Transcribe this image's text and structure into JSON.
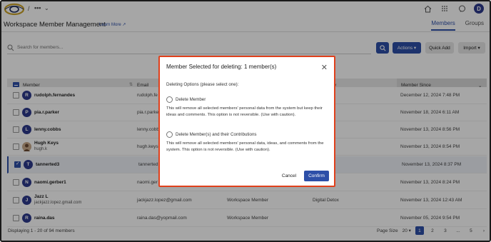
{
  "breadcrumb": {
    "separator": "/",
    "dots": "•••",
    "chevron": "⌄"
  },
  "header": {
    "title": "Workspace Member Management",
    "learn_more": "Learn More",
    "tabs": [
      {
        "label": "Members",
        "active": true
      },
      {
        "label": "Groups",
        "active": false
      }
    ]
  },
  "user": {
    "initial": "D"
  },
  "toolbar": {
    "search_placeholder": "Search for members...",
    "actions_label": "Actions ▾",
    "quick_add_label": "Quick Add",
    "import_label": "Import ▾"
  },
  "table": {
    "headers": {
      "member": "Member",
      "email": "Email",
      "role": "Role",
      "group": "y",
      "since": "Member Since"
    },
    "rows": [
      {
        "initial": "R",
        "name": "rudolph.fernandes",
        "sub": "",
        "email": "rudolph.fe",
        "role": "",
        "group": "",
        "since": "December 12, 2024 7:48 PM",
        "checked": false,
        "photo": false
      },
      {
        "initial": "P",
        "name": "pia.r.parker",
        "sub": "",
        "email": "pia.r.parker",
        "role": "",
        "group": "",
        "since": "November 18, 2024 6:11 AM",
        "checked": false,
        "photo": false
      },
      {
        "initial": "L",
        "name": "lenny.cobbs",
        "sub": "",
        "email": "lenny.cobb",
        "role": "",
        "group": "",
        "since": "November 13, 2024 8:56 PM",
        "checked": false,
        "photo": false
      },
      {
        "initial": "",
        "name": "Hugh Keys",
        "sub": "hugh.k",
        "email": "hugh.keys",
        "role": "",
        "group": "",
        "since": "November 13, 2024 8:54 PM",
        "checked": false,
        "photo": true
      },
      {
        "initial": "T",
        "name": "tannerted3",
        "sub": "",
        "email": "tannerted",
        "role": "",
        "group": "",
        "since": "November 13, 2024 8:37 PM",
        "checked": true,
        "photo": false
      },
      {
        "initial": "N",
        "name": "naomi.gerber1",
        "sub": "",
        "email": "naomi.ger",
        "role": "",
        "group": "",
        "since": "November 13, 2024 8:24 PM",
        "checked": false,
        "photo": false
      },
      {
        "initial": "J",
        "name": "Jazz L",
        "sub": "jackjazz.lopez.gmail.com",
        "email": "jackjazz.lopez@gmail.com",
        "role": "Workspace Member",
        "group": "Digital Detox",
        "since": "November 13, 2024 12:43 AM",
        "checked": false,
        "photo": false
      },
      {
        "initial": "R",
        "name": "raina.das",
        "sub": "",
        "email": "raina.das@yopmail.com",
        "role": "Workspace Member",
        "group": "",
        "since": "November 05, 2024 9:54 PM",
        "checked": false,
        "photo": false
      }
    ]
  },
  "footer": {
    "displaying": "Displaying 1 - 20 of 94 members",
    "page_size_label": "Page Size",
    "page_size_value": "20 ▾",
    "pages": [
      "1",
      "2",
      "3",
      "...",
      "5"
    ],
    "next": "›"
  },
  "modal": {
    "title": "Member Selected for deleting: 1 member(s)",
    "close": "✕",
    "options_label": "Deleting Options (please select one):",
    "option1_label": "Delete Member",
    "option1_desc": "This will remove all selected members' personal data from the system but keep their ideas and comments. This option is not reversible. (Use with caution).",
    "option2_label": "Delete Member(s) and their Contributions",
    "option2_desc": "This will remove all selected members' personal data, ideas, and comments from the system. This option is not reversible. (Use with caution).",
    "cancel_label": "Cancel",
    "confirm_label": "Confirm"
  },
  "colors": {
    "accent": "#2d4fa8",
    "modal_border": "#e0401c",
    "avatar": "#2d3a8c"
  }
}
